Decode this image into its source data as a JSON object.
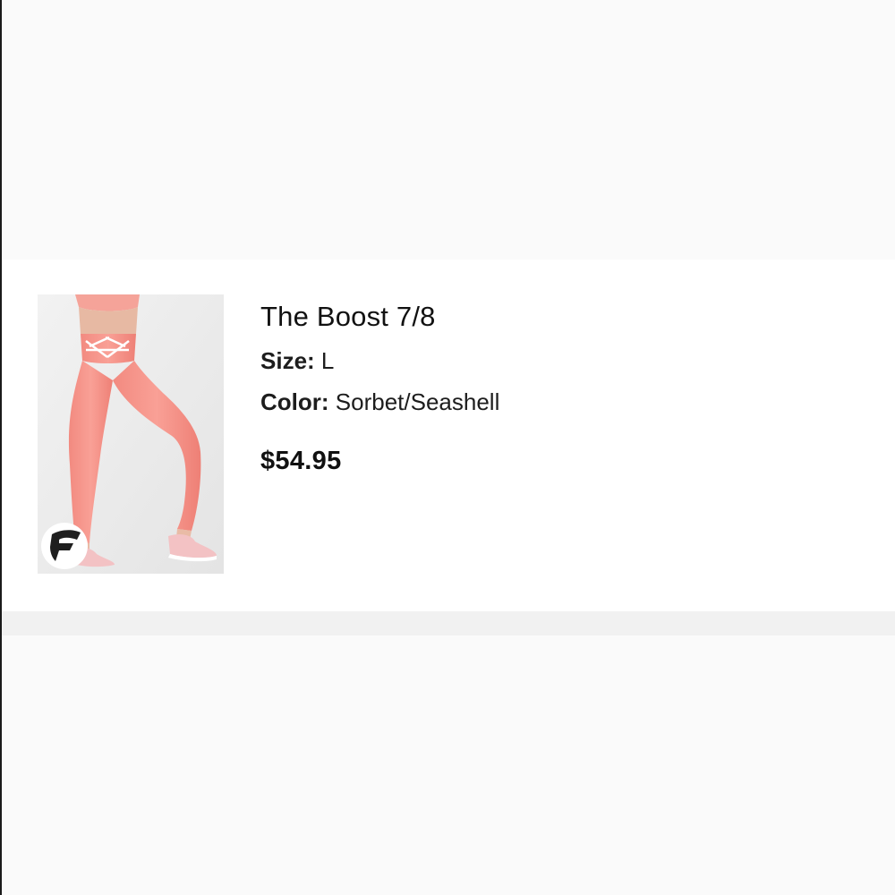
{
  "product": {
    "title": "The Boost 7/8",
    "size_label": "Size:",
    "size_value": "L",
    "color_label": "Color:",
    "color_value": "Sorbet/Seashell",
    "price": "$54.95",
    "image_icon": "brand-logo-icon",
    "image_subject": "leggings-photo"
  },
  "colors": {
    "background": "#fafafa",
    "card": "#ffffff",
    "band": "#f1f1f1",
    "garment": "#f78f85",
    "text": "#111111"
  }
}
